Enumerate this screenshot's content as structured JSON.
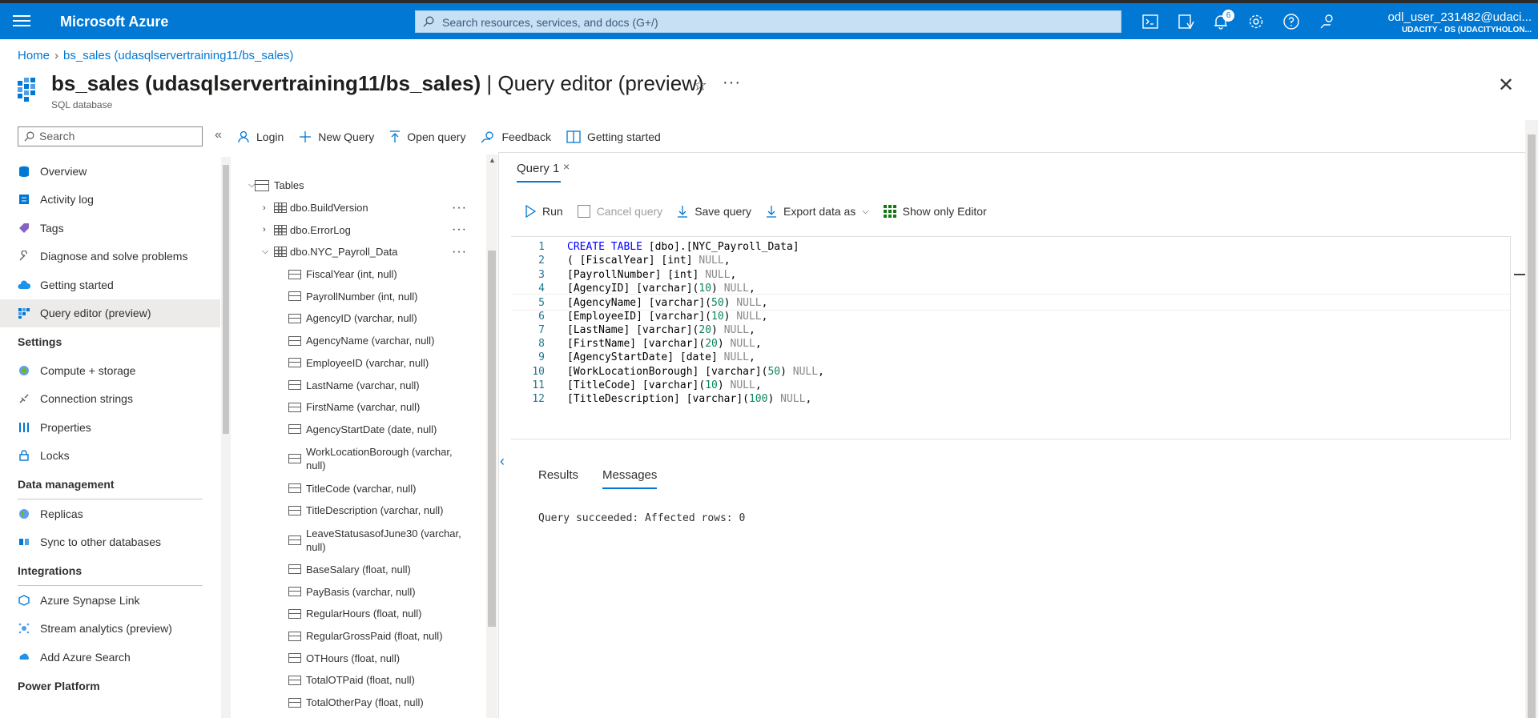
{
  "topbar": {
    "brand": "Microsoft Azure",
    "search_placeholder": "Search resources, services, and docs (G+/)",
    "notification_count": "6",
    "user_name": "odl_user_231482@udaci...",
    "user_tenant": "UDACITY - DS (UDACITYHOLON..."
  },
  "breadcrumb": {
    "home": "Home",
    "current": "bs_sales (udasqlservertraining11/bs_sales)"
  },
  "header": {
    "title_main": "bs_sales (udasqlservertraining11/bs_sales)",
    "title_suffix": " | Query editor (preview)",
    "subtitle": "SQL database"
  },
  "sidebar": {
    "search_placeholder": "Search",
    "items": [
      {
        "label": "Overview",
        "icon": "sql-db-icon"
      },
      {
        "label": "Activity log",
        "icon": "activity-log-icon"
      },
      {
        "label": "Tags",
        "icon": "tag-icon"
      },
      {
        "label": "Diagnose and solve problems",
        "icon": "wrench-icon"
      },
      {
        "label": "Getting started",
        "icon": "cloud-icon"
      },
      {
        "label": "Query editor (preview)",
        "icon": "query-editor-icon",
        "active": true
      }
    ],
    "settings_heading": "Settings",
    "settings_items": [
      {
        "label": "Compute + storage",
        "icon": "compute-icon"
      },
      {
        "label": "Connection strings",
        "icon": "connection-icon"
      },
      {
        "label": "Properties",
        "icon": "properties-icon"
      },
      {
        "label": "Locks",
        "icon": "lock-icon"
      }
    ],
    "data_heading": "Data management",
    "data_items": [
      {
        "label": "Replicas",
        "icon": "globe-icon"
      },
      {
        "label": "Sync to other databases",
        "icon": "sync-icon"
      }
    ],
    "integrations_heading": "Integrations",
    "integration_items": [
      {
        "label": "Azure Synapse Link",
        "icon": "synapse-icon"
      },
      {
        "label": "Stream analytics (preview)",
        "icon": "stream-icon"
      },
      {
        "label": "Add Azure Search",
        "icon": "azure-search-icon"
      }
    ],
    "power_heading": "Power Platform"
  },
  "toolbar": {
    "login": "Login",
    "new_query": "New Query",
    "open_query": "Open query",
    "feedback": "Feedback",
    "getting_started": "Getting started"
  },
  "tree": {
    "tables_label": "Tables",
    "tables": [
      {
        "name": "dbo.BuildVersion"
      },
      {
        "name": "dbo.ErrorLog"
      },
      {
        "name": "dbo.NYC_Payroll_Data"
      }
    ],
    "columns": [
      "FiscalYear (int, null)",
      "PayrollNumber (int, null)",
      "AgencyID (varchar, null)",
      "AgencyName (varchar, null)",
      "EmployeeID (varchar, null)",
      "LastName (varchar, null)",
      "FirstName (varchar, null)",
      "AgencyStartDate (date, null)",
      "WorkLocationBorough (varchar, null)",
      "TitleCode (varchar, null)",
      "TitleDescription (varchar, null)",
      "LeaveStatusasofJune30 (varchar, null)",
      "BaseSalary (float, null)",
      "PayBasis (varchar, null)",
      "RegularHours (float, null)",
      "RegularGrossPaid (float, null)",
      "OTHours (float, null)",
      "TotalOTPaid (float, null)",
      "TotalOtherPay (float, null)"
    ]
  },
  "editor": {
    "tab_label": "Query 1",
    "run": "Run",
    "cancel_query": "Cancel query",
    "save_query": "Save query",
    "export_data": "Export data as",
    "show_only_editor": "Show only Editor",
    "code_lines": [
      "CREATE TABLE [dbo].[NYC_Payroll_Data]",
      "( [FiscalYear] [int] NULL,",
      "[PayrollNumber] [int] NULL,",
      "[AgencyID] [varchar](10) NULL,",
      "[AgencyName] [varchar](50) NULL,",
      "[EmployeeID] [varchar](10) NULL,",
      "[LastName] [varchar](20) NULL,",
      "[FirstName] [varchar](20) NULL,",
      "[AgencyStartDate] [date] NULL,",
      "[WorkLocationBorough] [varchar](50) NULL,",
      "[TitleCode] [varchar](10) NULL,",
      "[TitleDescription] [varchar](100) NULL,"
    ]
  },
  "results": {
    "tab_results": "Results",
    "tab_messages": "Messages",
    "message": "Query succeeded: Affected rows: 0"
  },
  "colors": {
    "accent": "#0078d4",
    "topbar_bg": "#0078d4",
    "keyword": "#0000ff",
    "number": "#098658"
  }
}
